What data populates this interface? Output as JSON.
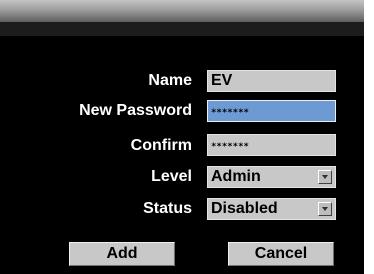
{
  "form": {
    "name_label": "Name",
    "name_value": "EV",
    "new_password_label": "New Password",
    "new_password_value": "*******",
    "confirm_label": "Confirm",
    "confirm_value": "*******",
    "level_label": "Level",
    "level_value": "Admin",
    "status_label": "Status",
    "status_value": "Disabled"
  },
  "buttons": {
    "add_label": "Add",
    "cancel_label": "Cancel"
  },
  "icons": {
    "dropdown": "chevron-down-icon"
  },
  "colors": {
    "background": "#000000",
    "field": "#c8c8c8",
    "focused_field": "#6d9ad2",
    "title_bar": "#9d9d9d"
  }
}
